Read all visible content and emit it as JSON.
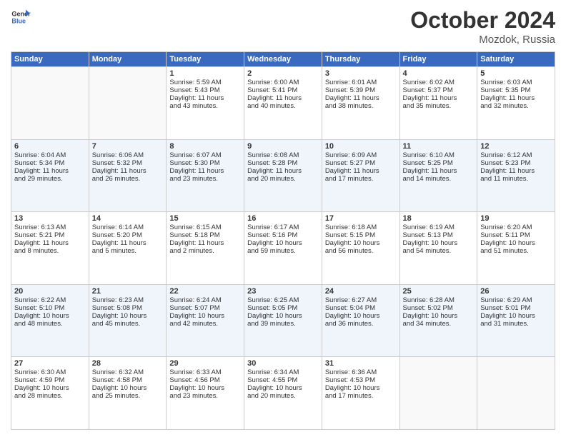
{
  "header": {
    "logo_line1": "General",
    "logo_line2": "Blue",
    "month": "October 2024",
    "location": "Mozdok, Russia"
  },
  "weekdays": [
    "Sunday",
    "Monday",
    "Tuesday",
    "Wednesday",
    "Thursday",
    "Friday",
    "Saturday"
  ],
  "rows": [
    [
      {
        "day": "",
        "lines": []
      },
      {
        "day": "",
        "lines": []
      },
      {
        "day": "1",
        "lines": [
          "Sunrise: 5:59 AM",
          "Sunset: 5:43 PM",
          "Daylight: 11 hours",
          "and 43 minutes."
        ]
      },
      {
        "day": "2",
        "lines": [
          "Sunrise: 6:00 AM",
          "Sunset: 5:41 PM",
          "Daylight: 11 hours",
          "and 40 minutes."
        ]
      },
      {
        "day": "3",
        "lines": [
          "Sunrise: 6:01 AM",
          "Sunset: 5:39 PM",
          "Daylight: 11 hours",
          "and 38 minutes."
        ]
      },
      {
        "day": "4",
        "lines": [
          "Sunrise: 6:02 AM",
          "Sunset: 5:37 PM",
          "Daylight: 11 hours",
          "and 35 minutes."
        ]
      },
      {
        "day": "5",
        "lines": [
          "Sunrise: 6:03 AM",
          "Sunset: 5:35 PM",
          "Daylight: 11 hours",
          "and 32 minutes."
        ]
      }
    ],
    [
      {
        "day": "6",
        "lines": [
          "Sunrise: 6:04 AM",
          "Sunset: 5:34 PM",
          "Daylight: 11 hours",
          "and 29 minutes."
        ]
      },
      {
        "day": "7",
        "lines": [
          "Sunrise: 6:06 AM",
          "Sunset: 5:32 PM",
          "Daylight: 11 hours",
          "and 26 minutes."
        ]
      },
      {
        "day": "8",
        "lines": [
          "Sunrise: 6:07 AM",
          "Sunset: 5:30 PM",
          "Daylight: 11 hours",
          "and 23 minutes."
        ]
      },
      {
        "day": "9",
        "lines": [
          "Sunrise: 6:08 AM",
          "Sunset: 5:28 PM",
          "Daylight: 11 hours",
          "and 20 minutes."
        ]
      },
      {
        "day": "10",
        "lines": [
          "Sunrise: 6:09 AM",
          "Sunset: 5:27 PM",
          "Daylight: 11 hours",
          "and 17 minutes."
        ]
      },
      {
        "day": "11",
        "lines": [
          "Sunrise: 6:10 AM",
          "Sunset: 5:25 PM",
          "Daylight: 11 hours",
          "and 14 minutes."
        ]
      },
      {
        "day": "12",
        "lines": [
          "Sunrise: 6:12 AM",
          "Sunset: 5:23 PM",
          "Daylight: 11 hours",
          "and 11 minutes."
        ]
      }
    ],
    [
      {
        "day": "13",
        "lines": [
          "Sunrise: 6:13 AM",
          "Sunset: 5:21 PM",
          "Daylight: 11 hours",
          "and 8 minutes."
        ]
      },
      {
        "day": "14",
        "lines": [
          "Sunrise: 6:14 AM",
          "Sunset: 5:20 PM",
          "Daylight: 11 hours",
          "and 5 minutes."
        ]
      },
      {
        "day": "15",
        "lines": [
          "Sunrise: 6:15 AM",
          "Sunset: 5:18 PM",
          "Daylight: 11 hours",
          "and 2 minutes."
        ]
      },
      {
        "day": "16",
        "lines": [
          "Sunrise: 6:17 AM",
          "Sunset: 5:16 PM",
          "Daylight: 10 hours",
          "and 59 minutes."
        ]
      },
      {
        "day": "17",
        "lines": [
          "Sunrise: 6:18 AM",
          "Sunset: 5:15 PM",
          "Daylight: 10 hours",
          "and 56 minutes."
        ]
      },
      {
        "day": "18",
        "lines": [
          "Sunrise: 6:19 AM",
          "Sunset: 5:13 PM",
          "Daylight: 10 hours",
          "and 54 minutes."
        ]
      },
      {
        "day": "19",
        "lines": [
          "Sunrise: 6:20 AM",
          "Sunset: 5:11 PM",
          "Daylight: 10 hours",
          "and 51 minutes."
        ]
      }
    ],
    [
      {
        "day": "20",
        "lines": [
          "Sunrise: 6:22 AM",
          "Sunset: 5:10 PM",
          "Daylight: 10 hours",
          "and 48 minutes."
        ]
      },
      {
        "day": "21",
        "lines": [
          "Sunrise: 6:23 AM",
          "Sunset: 5:08 PM",
          "Daylight: 10 hours",
          "and 45 minutes."
        ]
      },
      {
        "day": "22",
        "lines": [
          "Sunrise: 6:24 AM",
          "Sunset: 5:07 PM",
          "Daylight: 10 hours",
          "and 42 minutes."
        ]
      },
      {
        "day": "23",
        "lines": [
          "Sunrise: 6:25 AM",
          "Sunset: 5:05 PM",
          "Daylight: 10 hours",
          "and 39 minutes."
        ]
      },
      {
        "day": "24",
        "lines": [
          "Sunrise: 6:27 AM",
          "Sunset: 5:04 PM",
          "Daylight: 10 hours",
          "and 36 minutes."
        ]
      },
      {
        "day": "25",
        "lines": [
          "Sunrise: 6:28 AM",
          "Sunset: 5:02 PM",
          "Daylight: 10 hours",
          "and 34 minutes."
        ]
      },
      {
        "day": "26",
        "lines": [
          "Sunrise: 6:29 AM",
          "Sunset: 5:01 PM",
          "Daylight: 10 hours",
          "and 31 minutes."
        ]
      }
    ],
    [
      {
        "day": "27",
        "lines": [
          "Sunrise: 6:30 AM",
          "Sunset: 4:59 PM",
          "Daylight: 10 hours",
          "and 28 minutes."
        ]
      },
      {
        "day": "28",
        "lines": [
          "Sunrise: 6:32 AM",
          "Sunset: 4:58 PM",
          "Daylight: 10 hours",
          "and 25 minutes."
        ]
      },
      {
        "day": "29",
        "lines": [
          "Sunrise: 6:33 AM",
          "Sunset: 4:56 PM",
          "Daylight: 10 hours",
          "and 23 minutes."
        ]
      },
      {
        "day": "30",
        "lines": [
          "Sunrise: 6:34 AM",
          "Sunset: 4:55 PM",
          "Daylight: 10 hours",
          "and 20 minutes."
        ]
      },
      {
        "day": "31",
        "lines": [
          "Sunrise: 6:36 AM",
          "Sunset: 4:53 PM",
          "Daylight: 10 hours",
          "and 17 minutes."
        ]
      },
      {
        "day": "",
        "lines": []
      },
      {
        "day": "",
        "lines": []
      }
    ]
  ]
}
